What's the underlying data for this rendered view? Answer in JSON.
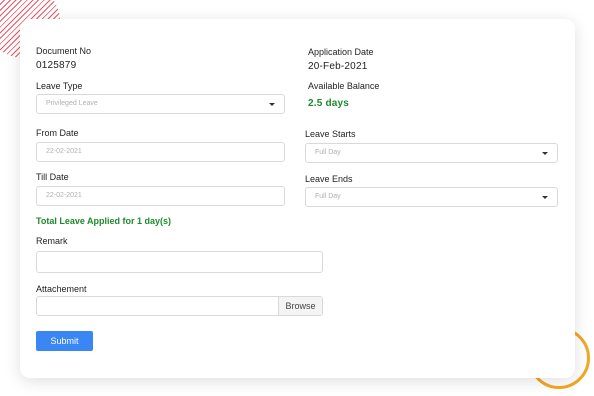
{
  "form": {
    "document_no": {
      "label": "Document No",
      "value": "0125879"
    },
    "application_date": {
      "label": "Application Date",
      "value": "20-Feb-2021"
    },
    "leave_type": {
      "label": "Leave Type",
      "value": "Privileged Leave"
    },
    "available_balance": {
      "label": "Available Balance",
      "value": "2.5 days"
    },
    "from_date": {
      "label": "From Date",
      "value": "22-02-2021"
    },
    "leave_starts": {
      "label": "Leave Starts",
      "value": "Full Day"
    },
    "till_date": {
      "label": "Till Date",
      "value": "22-02-2021"
    },
    "leave_ends": {
      "label": "Leave Ends",
      "value": "Full Day"
    },
    "total_leave_text": "Total Leave Applied for 1 day(s)",
    "remark": {
      "label": "Remark",
      "value": ""
    },
    "attachment": {
      "label": "Attachement",
      "value": "",
      "browse_label": "Browse"
    },
    "submit_label": "Submit"
  },
  "colors": {
    "accent": "#3a86f5",
    "success": "#1e8a2d",
    "decor_hatch": "#e2394a",
    "decor_ring": "#f5a623"
  }
}
